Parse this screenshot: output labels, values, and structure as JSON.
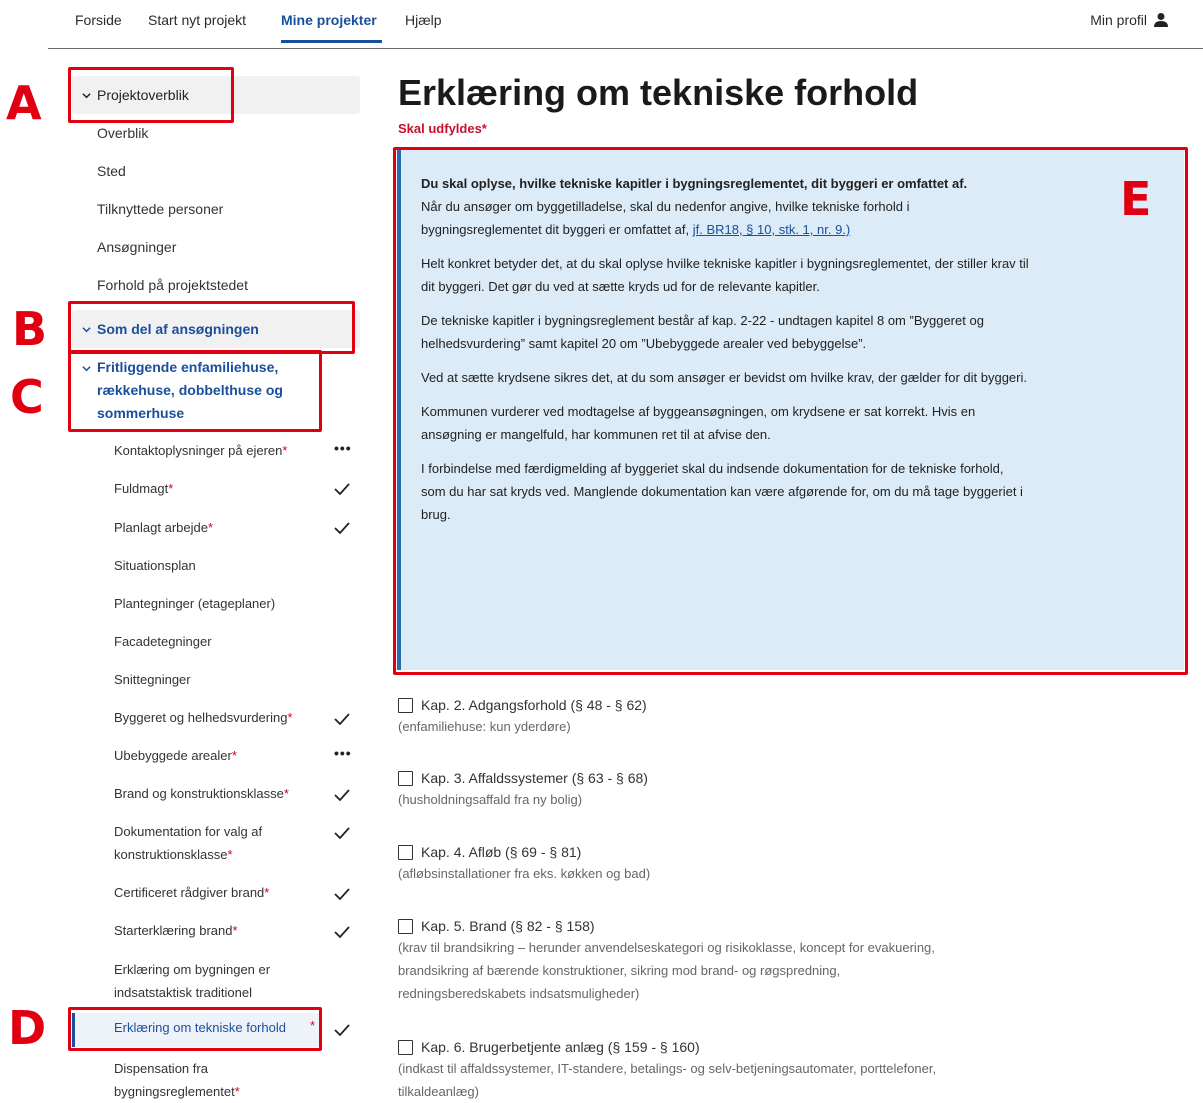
{
  "nav": {
    "items": [
      "Forside",
      "Start nyt projekt",
      "Mine projekter",
      "Hjælp"
    ],
    "active": "Mine projekter",
    "profile_label": "Min profil"
  },
  "sidebar": {
    "projektoverblik": "Projektoverblik",
    "overview_items": [
      "Overblik",
      "Sted",
      "Tilknyttede personer",
      "Ansøgninger",
      "Forhold på projektstedet"
    ],
    "som_del": "Som del af ansøgningen",
    "fritliggende": "Fritliggende enfamiliehuse, rækkehuse, dobbelthuse og sommerhuse",
    "sections": [
      {
        "label": "Kontaktoplysninger på ejeren",
        "required": "*",
        "status": "dots"
      },
      {
        "label": "Fuldmagt",
        "required": "*",
        "status": "check"
      },
      {
        "label": "Planlagt arbejde",
        "required": "*",
        "status": "check"
      },
      {
        "label": "Situationsplan",
        "required": "",
        "status": ""
      },
      {
        "label": "Plantegninger (etageplaner)",
        "required": "",
        "status": ""
      },
      {
        "label": "Facadetegninger",
        "required": "",
        "status": ""
      },
      {
        "label": "Snittegninger",
        "required": "",
        "status": ""
      },
      {
        "label": "Byggeret og helhedsvurdering",
        "required": "*",
        "status": "check"
      },
      {
        "label": "Ubebyggede arealer",
        "required": "*",
        "status": "dots"
      },
      {
        "label": "Brand og konstruktionsklasse",
        "required": "*",
        "status": "check"
      },
      {
        "label": "Dokumentation for valg af konstruktionsklasse",
        "required": "*",
        "status": "check"
      },
      {
        "label": "Certificeret rådgiver brand",
        "required": "*",
        "status": "check"
      },
      {
        "label": "Starterklæring brand",
        "required": "*",
        "status": "check"
      },
      {
        "label": "Erklæring om bygningen er indsatstaktisk traditionel",
        "required": "",
        "status": ""
      },
      {
        "label": "Erklæring om tekniske forhold",
        "required": "*",
        "status": "check"
      },
      {
        "label": "Dispensation fra bygningsreglementet",
        "required": "*",
        "status": ""
      }
    ]
  },
  "annotations": [
    "A",
    "B",
    "C",
    "D",
    "E"
  ],
  "main": {
    "title": "Erklæring om tekniske forhold",
    "required_note": "Skal udfyldes*",
    "info": {
      "lead": "Du skal oplyse, hvilke tekniske kapitler i bygningsreglementet, dit byggeri er omfattet af.",
      "p1_text": "Når du ansøger om byggetilladelse, skal du nedenfor angive, hvilke tekniske forhold i bygningsreglementet dit byggeri er omfattet af, ",
      "p1_link": "jf. BR18, § 10, stk. 1, nr. 9.)",
      "p2": "Helt konkret betyder det, at du skal oplyse hvilke tekniske kapitler i bygningsreglementet, der stiller krav til dit byggeri. Det gør du ved at sætte kryds ud for de relevante kapitler.",
      "p3": "De tekniske kapitler i bygningsreglement består af kap. 2-22 - undtagen kapitel 8 om ”Byggeret og helhedsvurdering” samt kapitel 20 om ”Ubebyggede arealer ved bebyggelse”.",
      "p4": "Ved at sætte krydsene sikres det, at du som ansøger er bevidst om hvilke krav, der gælder for dit byggeri.",
      "p5": "Kommunen vurderer ved modtagelse af byggeansøgningen, om krydsene er sat korrekt. Hvis en ansøgning er mangelfuld, har kommunen ret til at afvise den.",
      "p6": "I forbindelse med færdigmelding af byggeriet skal du indsende dokumentation for de tekniske forhold, som du har sat kryds ved. Manglende dokumentation kan være afgørende for, om du må tage byggeriet i brug."
    },
    "chapters": [
      {
        "label": "Kap. 2. Adgangsforhold (§ 48 - § 62)",
        "note": "(enfamiliehuse: kun yderdøre)"
      },
      {
        "label": "Kap. 3. Affaldssystemer (§ 63 - § 68)",
        "note": "(husholdningsaffald fra ny bolig)"
      },
      {
        "label": "Kap. 4. Afløb (§ 69 - § 81)",
        "note": "(afløbsinstallationer fra eks. køkken og bad)"
      },
      {
        "label": "Kap. 5. Brand (§ 82 - § 158)",
        "note": "(krav til brandsikring – herunder anvendelseskategori og risikoklasse, koncept for evakuering, brandsikring af bærende konstruktioner, sikring mod brand- og røgspredning, redningsberedskabets indsatsmuligheder)"
      },
      {
        "label": "Kap. 6. Brugerbetjente anlæg (§ 159 - § 160)",
        "note": "(indkast til affaldssystemer, IT-standere, betalings- og selv-betjeningsautomater, porttelefoner, tilkaldeanlæg)"
      }
    ]
  },
  "colors": {
    "accent": "#1a4f9c",
    "required": "#d0021b",
    "annotation": "#e00012",
    "info_bg": "#dbebf7"
  }
}
